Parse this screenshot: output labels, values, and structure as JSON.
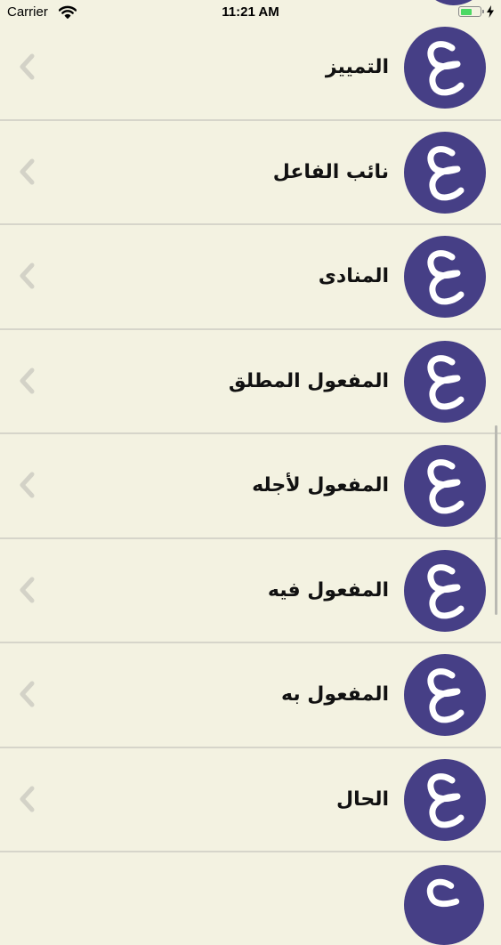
{
  "status_bar": {
    "carrier": "Carrier",
    "time": "11:21 AM",
    "battery_level": 0.6
  },
  "theme": {
    "background": "#f3f2e1",
    "avatar_color": "#463f86",
    "divider": "#d6d5ca"
  },
  "list": {
    "avatar_icon": "arabic-letter-ain-icon",
    "chevron_icon": "chevron-left-icon",
    "items": [
      {
        "label": "التمييز"
      },
      {
        "label": "نائب الفاعل"
      },
      {
        "label": "المنادى"
      },
      {
        "label": "المفعول المطلق"
      },
      {
        "label": "المفعول لأجله"
      },
      {
        "label": "المفعول فيه"
      },
      {
        "label": "المفعول به"
      },
      {
        "label": "الحال"
      }
    ]
  }
}
